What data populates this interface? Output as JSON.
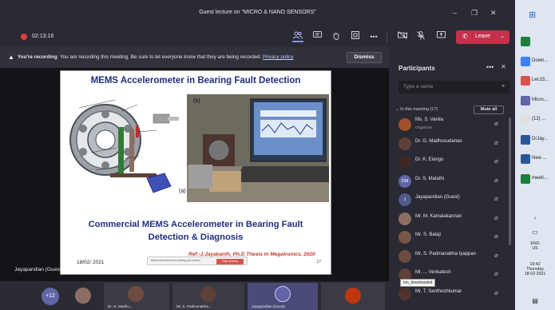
{
  "window": {
    "title": "Guest lecture on \"MICRO & NANO SENSORS\"",
    "controls": [
      "–",
      "❐",
      "✕"
    ]
  },
  "toolbar": {
    "timer": "02:13:16",
    "leave_label": "Leave"
  },
  "banner": {
    "bold": "You're recording",
    "message": "You are recording this meeting. Be sure to let everyone know that they are being recorded.",
    "link": "Privacy policy",
    "dismiss": "Dismiss"
  },
  "slide": {
    "title": "MEMS Accelerometer in Bearing Fault Detection",
    "label_b": "(b)",
    "label_a": "(a)",
    "subtitle_line1": "Commercial MEMS Accelerometer in Bearing Fault",
    "subtitle_line2": "Detection & Diagnosis",
    "reference": "Ref:-J.Jayakanth, Ph.D Thesis in Megatronics, 2020",
    "date": "18/02/ 2021",
    "pill_text": "teams.microsoft.com is sharing your screen.",
    "pill_button": "Stop sharing",
    "page": "17"
  },
  "presenter": "Jayapandian (Guest)",
  "gallery": {
    "more": "+12",
    "tiles": [
      "Dr. G. Madhu...",
      "Mr. S. Padmanabha...",
      "Jayapandian (Guest)"
    ]
  },
  "participants": {
    "title": "Participants",
    "search_placeholder": "Type a name",
    "section": "In this meeting (17)",
    "mute_all": "Mute all",
    "list": [
      {
        "name": "Ms. S. Vanila",
        "role": "Organizer",
        "color": "#a0522d"
      },
      {
        "name": "Dr. G. Madhusudanan",
        "role": "",
        "color": "#5d4037"
      },
      {
        "name": "Dr. K. Elango",
        "role": "",
        "color": "#3e2723"
      },
      {
        "name": "Dr. S. Malathi",
        "role": "",
        "color": "#6264a7",
        "initials": "DM"
      },
      {
        "name": "Jayapandian (Guest)",
        "role": "",
        "color": "#4e5a8a",
        "initials": "J"
      },
      {
        "name": "Mr. M. Kamalakannan",
        "role": "",
        "color": "#8d6e63"
      },
      {
        "name": "Mr. S. Balaji",
        "role": "",
        "color": "#795548"
      },
      {
        "name": "Mr. S. Padmanabha Iyappan",
        "role": "",
        "color": "#6d4c41"
      },
      {
        "name": "Mr. ... Venkatesh",
        "role": "",
        "color": "#5d4037"
      },
      {
        "name": "Mr. T. Santhoshkumar",
        "role": "",
        "color": "#4e342e"
      }
    ],
    "tooltip": "ion_downloaded"
  },
  "taskbar": {
    "apps": [
      {
        "label": "",
        "color": "#1d7f3c"
      },
      {
        "label": "Down...",
        "color": "#3b82f6"
      },
      {
        "label": "Lec15...",
        "color": "#d9534f"
      },
      {
        "label": "Micro...",
        "color": "#6264a7"
      },
      {
        "label": "(12) ...",
        "color": "#e0e0e0"
      },
      {
        "label": "DrJay...",
        "color": "#2b579a"
      },
      {
        "label": "New ...",
        "color": "#2b579a"
      },
      {
        "label": "meeti...",
        "color": "#1d7f3c"
      }
    ],
    "lang": "ENG",
    "region": "US",
    "time": "19:42",
    "day": "Thursday",
    "date": "18-02-2021"
  }
}
